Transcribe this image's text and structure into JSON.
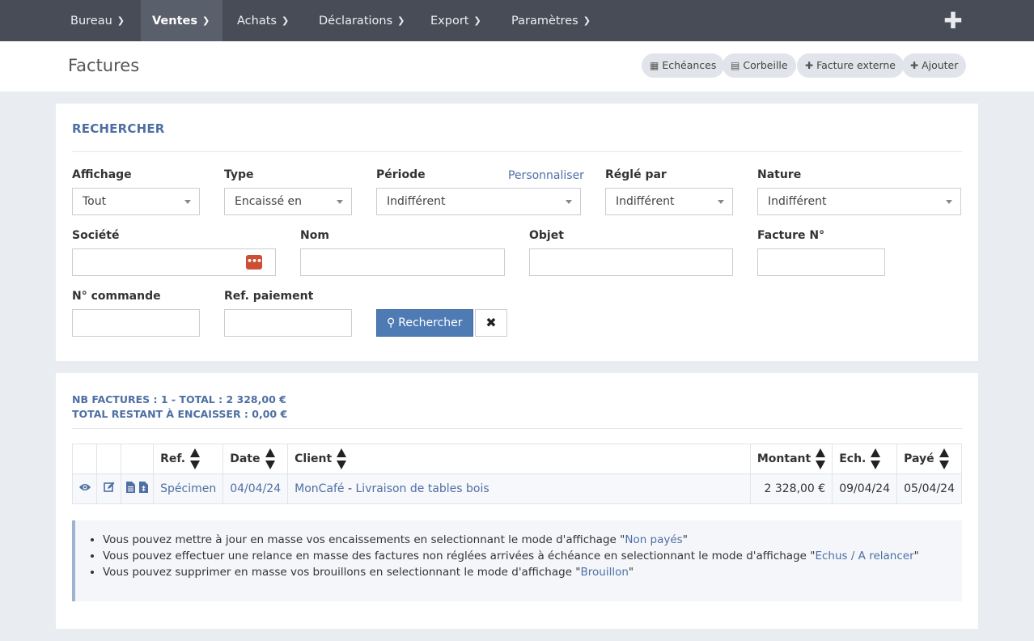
{
  "nav": {
    "items": [
      {
        "label": "Bureau"
      },
      {
        "label": "Ventes"
      },
      {
        "label": "Achats"
      },
      {
        "label": "Déclarations"
      },
      {
        "label": "Export"
      },
      {
        "label": "Paramètres"
      }
    ],
    "active": "Ventes",
    "plus_icon": "plus-icon"
  },
  "header": {
    "title": "Factures",
    "buttons": [
      {
        "label": "Echéances",
        "icon": "calendar-icon"
      },
      {
        "label": "Corbeille",
        "icon": "trash-icon"
      },
      {
        "label": "Facture externe",
        "icon": "plus-icon"
      },
      {
        "label": "Ajouter",
        "icon": "plus-icon"
      }
    ]
  },
  "search": {
    "title": "RECHERCHER",
    "affichage": {
      "label": "Affichage",
      "value": "Tout"
    },
    "type": {
      "label": "Type",
      "value": "Encaissé en"
    },
    "periode": {
      "label": "Période",
      "value": "Indifférent",
      "link": "Personnaliser"
    },
    "regle_par": {
      "label": "Réglé par",
      "value": "Indifférent"
    },
    "nature": {
      "label": "Nature",
      "value": "Indifférent"
    },
    "societe": {
      "label": "Société",
      "value": ""
    },
    "nom": {
      "label": "Nom",
      "value": ""
    },
    "objet": {
      "label": "Objet",
      "value": ""
    },
    "facture_no": {
      "label": "Facture N°",
      "value": ""
    },
    "commande_no": {
      "label": "N° commande",
      "value": ""
    },
    "ref_paiement": {
      "label": "Ref. paiement",
      "value": ""
    },
    "search_button": "Rechercher",
    "clear_icon": "close-icon"
  },
  "results": {
    "summary_line1": "NB FACTURES : 1 - TOTAL : 2 328,00 €",
    "summary_line2": "TOTAL RESTANT À ENCAISSER : 0,00 €",
    "columns": [
      "Ref.",
      "Date",
      "Client",
      "Montant",
      "Ech.",
      "Payé"
    ],
    "rows": [
      {
        "ref": "Spécimen",
        "date": "04/04/24",
        "client": "MonCafé",
        "separator": " - ",
        "objet": "Livraison de tables bois",
        "montant": "2 328,00 €",
        "ech": "09/04/24",
        "paye": "05/04/24"
      }
    ]
  },
  "info": {
    "tips": [
      {
        "text": "Vous pouvez mettre à jour en masse vos encaissements en selectionnant le mode d'affichage \"",
        "link": "Non payés",
        "end": "\""
      },
      {
        "text": "Vous pouvez effectuer une relance en masse des factures non réglées arrivées à échéance en selectionnant le mode d'affichage \"",
        "link": "Echus / A relancer",
        "end": "\""
      },
      {
        "text": "Vous pouvez supprimer en masse vos brouillons en selectionnant le mode d'affichage \"",
        "link": "Brouillon",
        "end": "\""
      }
    ]
  },
  "colors": {
    "nav_bg": "#474c57",
    "accent": "#4e6fa3",
    "primary_button": "#4f7bb5",
    "dots_button": "#cc4f35"
  }
}
